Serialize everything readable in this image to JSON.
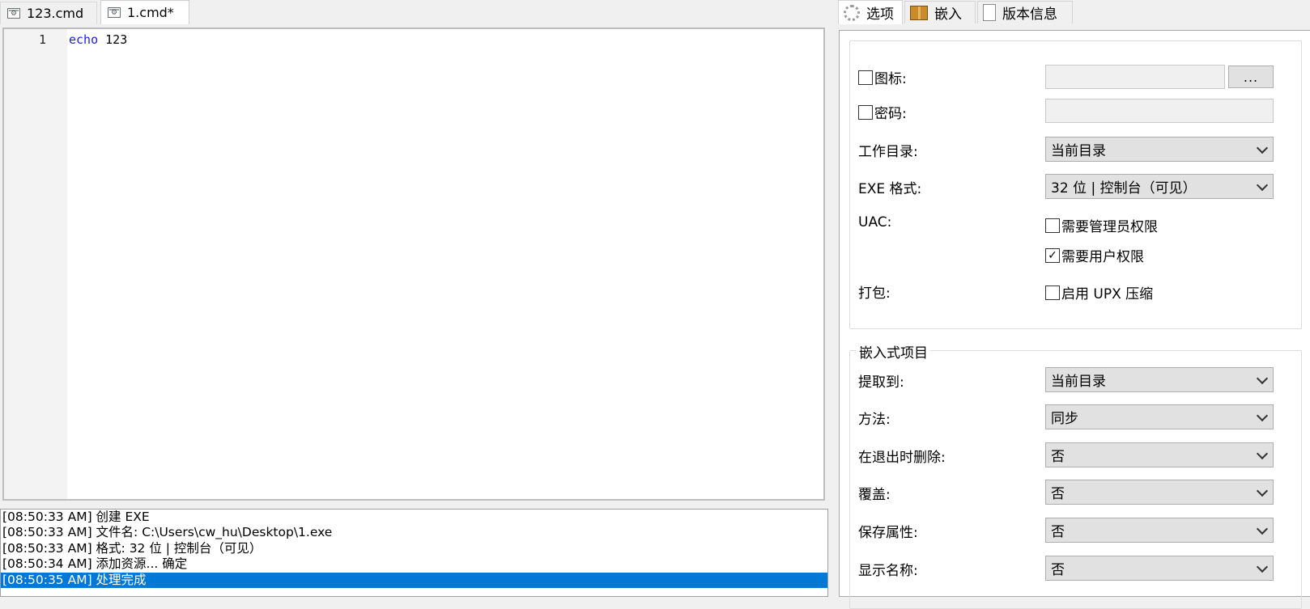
{
  "editor_tabs": [
    {
      "label": "123.cmd"
    },
    {
      "label": "1.cmd*"
    }
  ],
  "editor": {
    "line_number": "1",
    "keyword": "echo",
    "argument": " 123"
  },
  "log": [
    "[08:50:33 AM] 创建 EXE",
    "[08:50:33 AM] 文件名: C:\\Users\\cw_hu\\Desktop\\1.exe",
    "[08:50:33 AM] 格式: 32 位 | 控制台（可见）",
    "[08:50:34 AM] 添加资源... 确定",
    "[08:50:35 AM] 处理完成"
  ],
  "right_tabs": [
    {
      "label": "选项",
      "icon": "gear-icon"
    },
    {
      "label": "嵌入",
      "icon": "package-icon"
    },
    {
      "label": "版本信息",
      "icon": "document-icon"
    }
  ],
  "options": {
    "icon_label": "图标:",
    "browse_label": "...",
    "password_label": "密码:",
    "workdir_label": "工作目录:",
    "workdir_value": "当前目录",
    "exe_format_label": "EXE 格式:",
    "exe_format_value": "32 位 | 控制台（可见）",
    "uac_label": "UAC:",
    "uac_admin_label": "需要管理员权限",
    "uac_user_label": "需要用户权限",
    "pack_label": "打包:",
    "upx_label": "启用 UPX 压缩"
  },
  "embedded": {
    "legend": "嵌入式项目",
    "extract_label": "提取到:",
    "extract_value": "当前目录",
    "method_label": "方法:",
    "method_value": "同步",
    "delete_label": "在退出时删除:",
    "delete_value": "否",
    "overwrite_label": "覆盖:",
    "overwrite_value": "否",
    "keep_attr_label": "保存属性:",
    "keep_attr_value": "否",
    "show_name_label": "显示名称:",
    "show_name_value": "否"
  },
  "checkbox_states": {
    "icon": false,
    "password": false,
    "uac_admin": false,
    "uac_user": true,
    "upx": false
  },
  "colors": {
    "keyword": "#1a1aff",
    "log_selection": "#0078d7"
  }
}
